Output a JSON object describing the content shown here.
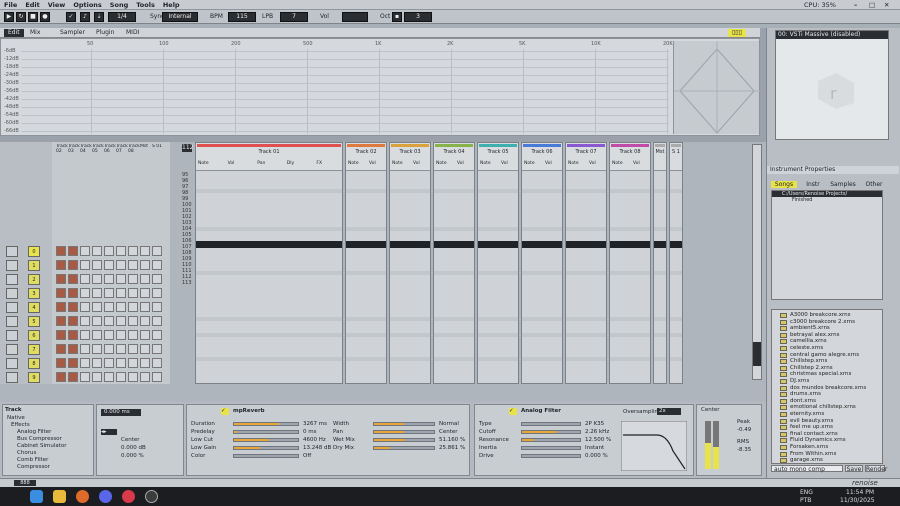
{
  "menu": [
    "File",
    "Edit",
    "View",
    "Options",
    "Song",
    "Tools",
    "Help"
  ],
  "transport": {
    "pattern": "1/4",
    "sync_label": "Sync",
    "sync_value": "Internal",
    "bpm_label": "BPM",
    "bpm": "115",
    "lpb_label": "LPB",
    "lpb": "7",
    "vol_label": "Vol",
    "oct_label": "Oct",
    "oct": "3"
  },
  "top_right": {
    "cpu": "CPU: 35%",
    "track_label": "Track"
  },
  "tabs": [
    "Edit",
    "Mix",
    "Sampler",
    "Plugin",
    "MIDI"
  ],
  "spectrum": {
    "y_labels": [
      "-6dB",
      "-12dB",
      "-18dB",
      "-24dB",
      "-30dB",
      "-36dB",
      "-42dB",
      "-48dB",
      "-54dB",
      "-60dB",
      "-66dB"
    ],
    "x_labels": [
      "50",
      "100",
      "200",
      "500",
      "1K",
      "2K",
      "5K",
      "10K",
      "20K"
    ]
  },
  "tracks": [
    {
      "name": "Track 01",
      "color": "#e05050"
    },
    {
      "name": "Track 02",
      "color": "#e07a3c"
    },
    {
      "name": "Track 03",
      "color": "#d9a23a"
    },
    {
      "name": "Track 04",
      "color": "#87b34a"
    },
    {
      "name": "Track 05",
      "color": "#3cb0b0"
    },
    {
      "name": "Track 06",
      "color": "#4a7ad9"
    },
    {
      "name": "Track 07",
      "color": "#8a58d0"
    },
    {
      "name": "Track 08",
      "color": "#c04ca8"
    },
    {
      "name": "Mst",
      "color": "#aaaaaa"
    },
    {
      "name": "S 1",
      "color": "#aaaaaa"
    }
  ],
  "track_col_labels": [
    "Note",
    "Vol",
    "Pan",
    "Dly",
    "FX"
  ],
  "pattern_header": [
    "Track 02",
    "Track 03",
    "Track 04",
    "Track 05",
    "Track 06",
    "Track 07",
    "Track 08",
    "Mst",
    "S 01"
  ],
  "line_numbers": [
    "95",
    "96",
    "97",
    "98",
    "99",
    "100",
    "101",
    "102",
    "103",
    "104",
    "105",
    "106",
    "107",
    "108",
    "109",
    "110",
    "111",
    "112",
    "113"
  ],
  "pattern_slots": [
    "0",
    "1",
    "2",
    "3",
    "4",
    "5",
    "6",
    "7",
    "8",
    "9"
  ],
  "instrument_props": "Instrument Properties",
  "instrument_name": "00: VSTi Massive (disabled)",
  "browser_tabs": [
    "Songs",
    "Instr",
    "Samples",
    "Other"
  ],
  "browser_root": "C:/Users/Renoise Projects/",
  "browser_sub": "Finished",
  "files": [
    "A3000 breakcore.xrns",
    "c3000 breakcore 2.xrns",
    "ambient5.xrns",
    "betrayal alex.xrns",
    "camellia.xrns",
    "celeste.xrns",
    "central gamo alegre.xrns",
    "Chillstep.xrns",
    "Chillstep 2.xrns",
    "christmas special.xrns",
    "DJ.xrns",
    "dos mundos breakcore.xrns",
    "drums.xrns",
    "dont.xrns",
    "emotional chillstep.xrns",
    "eternity.xrns",
    "evil beauty.xrns",
    "feel me up.xrns",
    "final contact.xrns",
    "Fluid Dynamics.xrns",
    "Forsaken.xrns",
    "From Within.xrns",
    "garage.xrns"
  ],
  "browser_footer": {
    "search": "auto mono comp",
    "save": "Save",
    "render": "Render"
  },
  "dsp_panel1": {
    "title": "Track",
    "items": [
      "Native",
      "Effects",
      "Analog Filter",
      "Bus Compressor",
      "Cabinet Simulator",
      "Chorus",
      "Comb Filter",
      "Compressor"
    ]
  },
  "dsp_panel2": {
    "value1": "0.000 ms",
    "center": "Center",
    "db": "0.000 dB",
    "pct": "0.000 %"
  },
  "reverb": {
    "title": "mpReverb",
    "rows": [
      [
        "Duration",
        "3267 ms"
      ],
      [
        "Predelay",
        "0 ms"
      ],
      [
        "Low Cut",
        "4600 Hz"
      ],
      [
        "Low Gain",
        "13.248 dB"
      ],
      [
        "Color",
        "Off"
      ]
    ],
    "rows2": [
      [
        "Width",
        "Normal"
      ],
      [
        "Pan",
        "Center"
      ],
      [
        "Wet Mix",
        "51.160 %"
      ],
      [
        "Dry Mix",
        "25.861 %"
      ]
    ]
  },
  "analog_filter": {
    "title": "Analog Filter",
    "rows": [
      [
        "Type",
        "2P K35"
      ],
      [
        "Cutoff",
        "2.26 kHz"
      ],
      [
        "Resonance",
        "12.500 %"
      ],
      [
        "Inertia",
        "Instant"
      ],
      [
        "Drive",
        "0.000 %"
      ]
    ],
    "oversampling": "Oversampling",
    "os_value": "2x"
  },
  "meter": {
    "center": "Center",
    "peak": "Peak",
    "peak_val": "-0.49",
    "rms": "RMS",
    "rms_val": "-8.35"
  },
  "statusbar": {
    "left": "888"
  },
  "tray": {
    "lang": "ENG",
    "layout": "PTB",
    "time": "11:54 PM",
    "date": "11/30/2025"
  },
  "logo": "renoise"
}
